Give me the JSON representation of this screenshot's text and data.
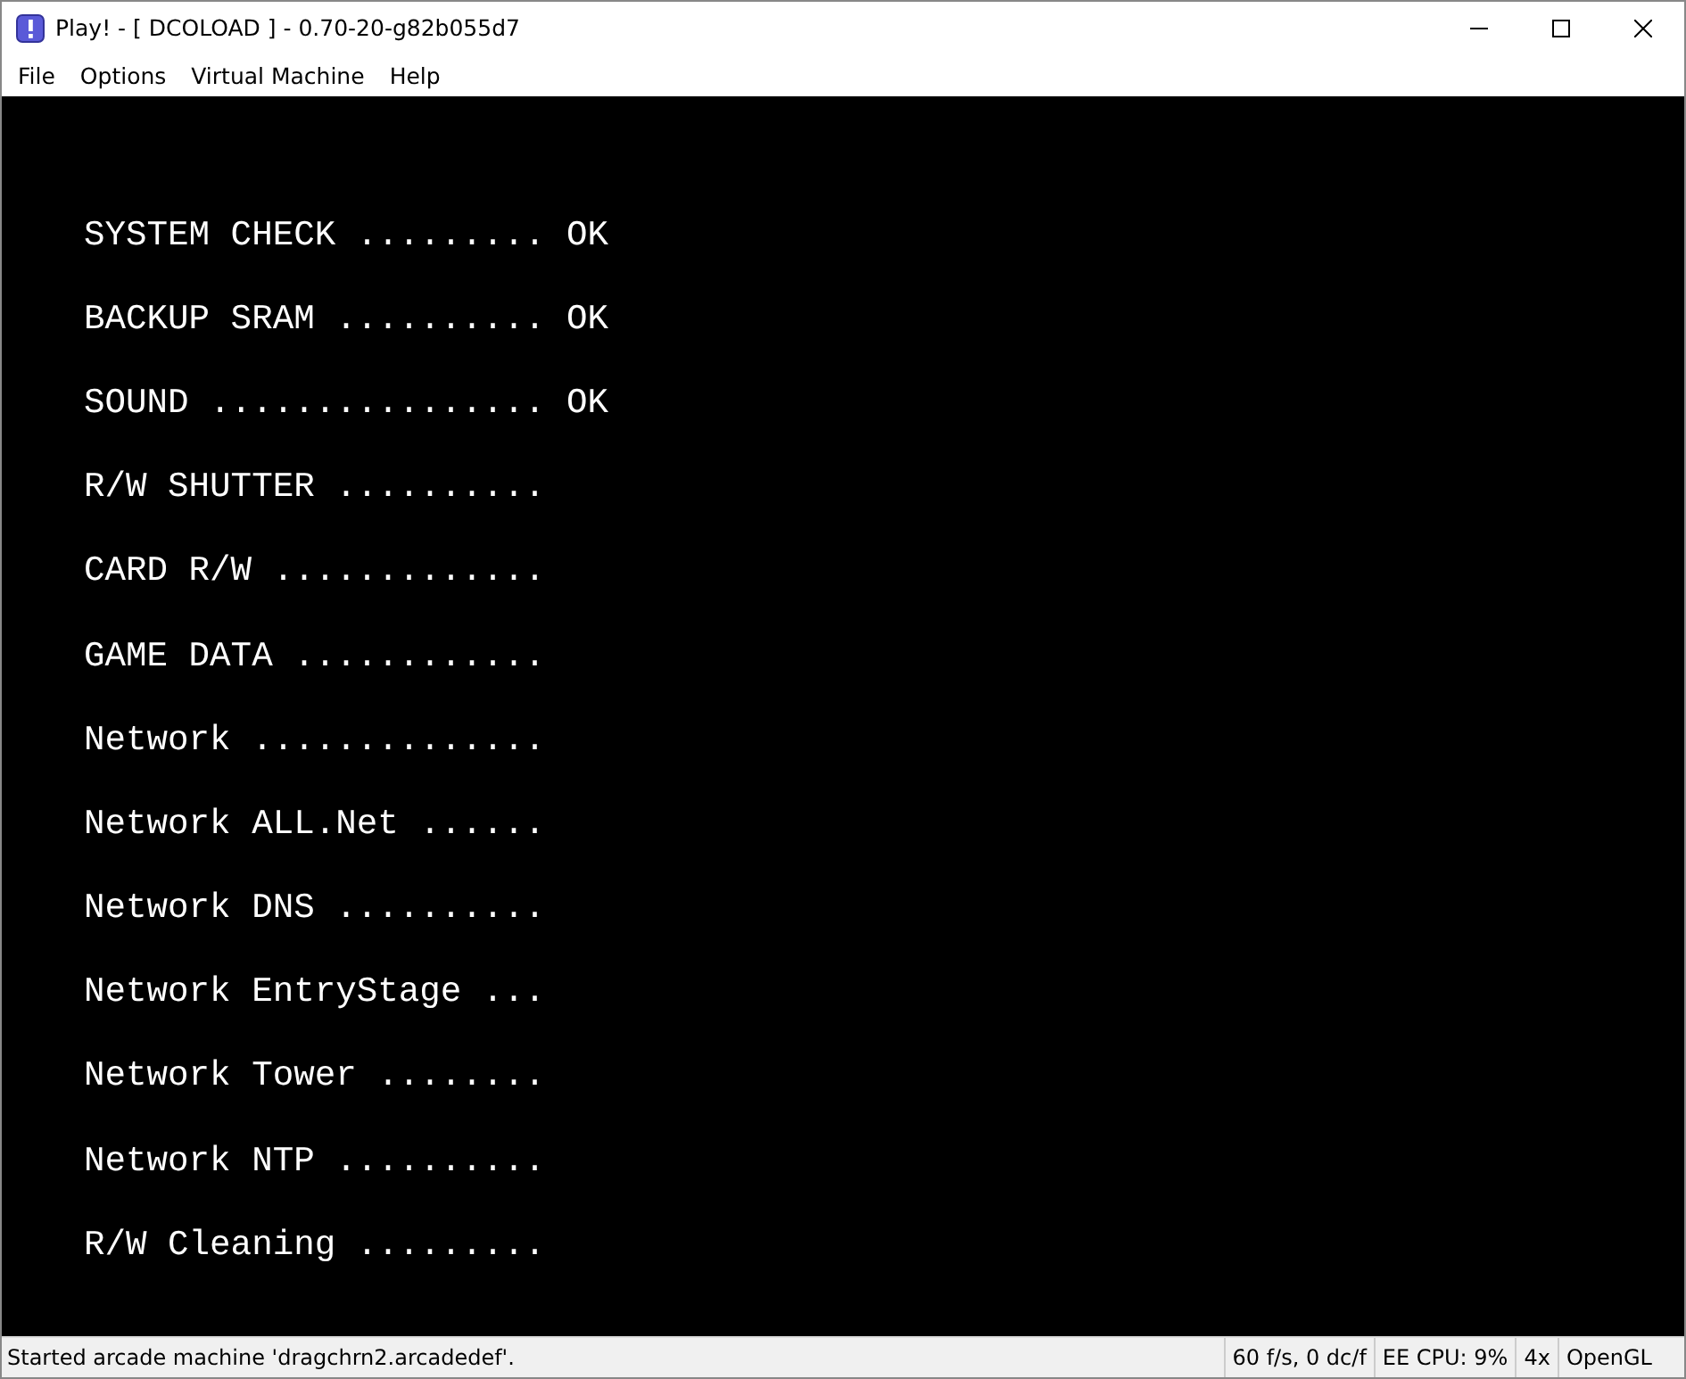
{
  "window": {
    "title": "Play! - [ DCOLOAD ] - 0.70-20-g82b055d7"
  },
  "menu": [
    "File",
    "Options",
    "Virtual Machine",
    "Help"
  ],
  "screen": {
    "lines": [
      {
        "label": "SYSTEM CHECK .........",
        "result": "OK"
      },
      {
        "label": "BACKUP SRAM ..........",
        "result": "OK"
      },
      {
        "label": "SOUND ................",
        "result": "OK"
      },
      {
        "label": "R/W SHUTTER .........."
      },
      {
        "label": "CARD R/W ............."
      },
      {
        "label": "GAME DATA ............"
      },
      {
        "label": "Network .............."
      },
      {
        "label": "Network ALL.Net ......"
      },
      {
        "label": "Network DNS .........."
      },
      {
        "label": "Network EntryStage ..."
      },
      {
        "label": "Network Tower ........"
      },
      {
        "label": "Network NTP .........."
      },
      {
        "label": "R/W Cleaning ........."
      }
    ]
  },
  "status_bar": {
    "message": "Started arcade machine 'dragchrn2.arcadedef'.",
    "panels": [
      "60 f/s, 0 dc/f",
      "EE CPU: 9%",
      "4x",
      "OpenGL"
    ]
  }
}
